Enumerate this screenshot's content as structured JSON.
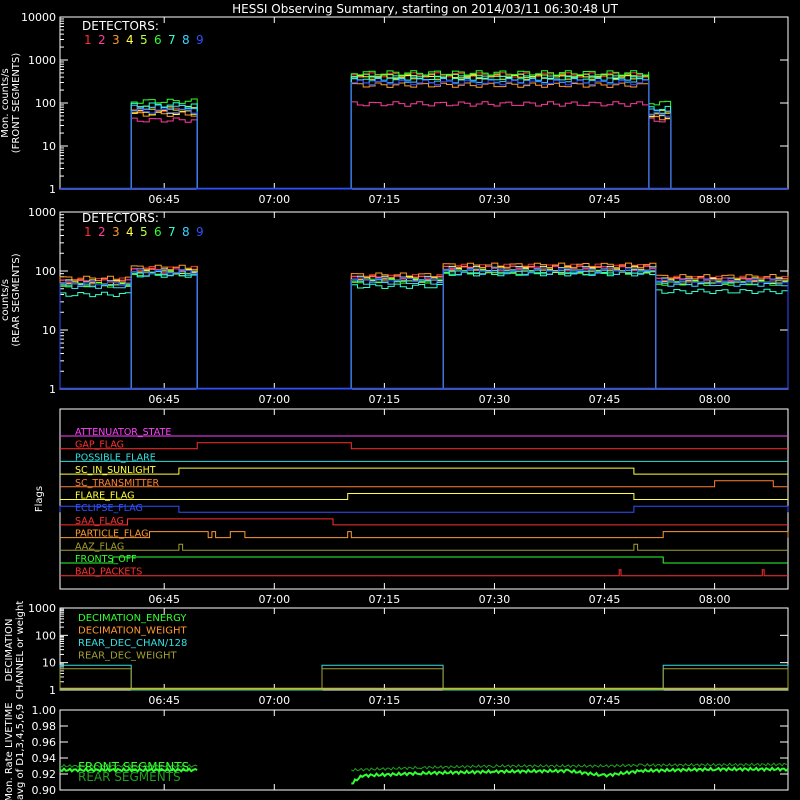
{
  "title": "HESSI Observing Summary, starting on 2014/03/11 06:30:48 UT",
  "colors": {
    "frame": "#ffffff",
    "background": "#000000",
    "det": [
      "#ff3030",
      "#ff3ca0",
      "#ff9a30",
      "#ffff40",
      "#b8ff40",
      "#30ff30",
      "#30ffd0",
      "#40d0ff",
      "#3050ff"
    ]
  },
  "time_axis": {
    "start": "06:30:48",
    "end": "08:10:00",
    "tick_labels": [
      "06:45",
      "07:00",
      "07:15",
      "07:30",
      "07:45",
      "08:00"
    ]
  },
  "detectors_legend": {
    "label": "DETECTORS:",
    "numbers": [
      "1",
      "2",
      "3",
      "4",
      "5",
      "6",
      "7",
      "8",
      "9"
    ]
  },
  "front_panel": {
    "ylabel_line1": "Mon. counts/s",
    "ylabel_line2": "(FRONT SEGMENTS)",
    "ytick_labels": [
      "10000",
      "1000",
      "100",
      "10",
      "1"
    ]
  },
  "rear_panel": {
    "ylabel_line1": "counts/s",
    "ylabel_line2": "(REAR SEGMENTS)",
    "ytick_labels": [
      "1000",
      "100",
      "10",
      "1"
    ]
  },
  "flags_panel": {
    "ylabel": "Flags",
    "flags": [
      {
        "name": "ATTENUATOR_STATE",
        "color": "#ff40ff"
      },
      {
        "name": "GAP_FLAG",
        "color": "#ff3030"
      },
      {
        "name": "POSSIBLE_FLARE",
        "color": "#30e0e0"
      },
      {
        "name": "SC_IN_SUNLIGHT",
        "color": "#ffff40"
      },
      {
        "name": "SC_TRANSMITTER",
        "color": "#ff8030"
      },
      {
        "name": "FLARE_FLAG",
        "color": "#ffff40"
      },
      {
        "name": "ECLIPSE_FLAG",
        "color": "#3050ff"
      },
      {
        "name": "SAA_FLAG",
        "color": "#ff3030"
      },
      {
        "name": "PARTICLE_FLAG",
        "color": "#ff9a30"
      },
      {
        "name": "AAZ_FLAG",
        "color": "#a0a030"
      },
      {
        "name": "FRONTS_OFF",
        "color": "#30ff30"
      },
      {
        "name": "BAD_PACKETS",
        "color": "#ff3030"
      }
    ]
  },
  "decimation_panel": {
    "ylabel_line1": "DECIMATION",
    "ylabel_line2": "CHANNEL or weight",
    "ytick_labels": [
      "1000",
      "100",
      "10",
      "1"
    ],
    "legend": [
      {
        "name": "DECIMATION_ENERGY",
        "color": "#30ff30"
      },
      {
        "name": "DECIMATION_WEIGHT",
        "color": "#ff9a30"
      },
      {
        "name": "REAR_DEC_CHAN/128",
        "color": "#30e0e0"
      },
      {
        "name": "REAR_DEC_WEIGHT",
        "color": "#a0a030"
      }
    ]
  },
  "livetime_panel": {
    "ylabel_line1": "Mon. Rate LIVETIME",
    "ylabel_line2": "avg of D1,3,4,5,6,9",
    "ytick_labels": [
      "1.00",
      "0.98",
      "0.96",
      "0.94",
      "0.92",
      "0.90"
    ],
    "legend": [
      {
        "name": "FRONT SEGMENTS",
        "color": "#30ff30"
      },
      {
        "name": "REAR SEGMENTS",
        "color": "#20a020"
      }
    ]
  },
  "chart_data": [
    {
      "type": "line",
      "panel": "front",
      "scale": "log",
      "ylim": [
        1,
        10000
      ],
      "segments": [
        {
          "start": "06:40:30",
          "end": "06:49:30",
          "det_values": [
            70,
            40,
            55,
            60,
            75,
            110,
            90,
            80,
            65
          ]
        },
        {
          "start": "07:10:30",
          "end": "07:51:00",
          "det_values": [
            450,
            95,
            260,
            400,
            420,
            500,
            380,
            330,
            300
          ]
        },
        {
          "start": "07:51:00",
          "end": "07:54:00",
          "det_values": [
            55,
            40,
            45,
            50,
            60,
            100,
            75,
            65,
            55
          ]
        }
      ],
      "baseline": 1
    },
    {
      "type": "line",
      "panel": "rear",
      "scale": "log",
      "ylim": [
        1,
        1000
      ],
      "segments": [
        {
          "start": "06:30:48",
          "end": "06:40:30",
          "det_values": [
            70,
            65,
            75,
            65,
            60,
            58,
            40,
            55,
            62
          ]
        },
        {
          "start": "06:40:30",
          "end": "06:49:30",
          "det_values": [
            110,
            100,
            115,
            100,
            95,
            90,
            85,
            90,
            98
          ]
        },
        {
          "start": "07:10:30",
          "end": "07:23:00",
          "det_values": [
            80,
            75,
            85,
            75,
            70,
            68,
            55,
            65,
            72
          ]
        },
        {
          "start": "07:23:00",
          "end": "07:52:00",
          "det_values": [
            120,
            110,
            125,
            110,
            100,
            95,
            90,
            95,
            105
          ]
        },
        {
          "start": "07:52:00",
          "end": "08:10:00",
          "det_values": [
            75,
            70,
            80,
            70,
            65,
            62,
            45,
            60,
            68
          ]
        }
      ],
      "baseline": 1
    },
    {
      "type": "table",
      "panel": "flags",
      "flags": [
        {
          "name": "ATTENUATOR_STATE",
          "intervals": []
        },
        {
          "name": "GAP_FLAG",
          "intervals": [
            [
              "06:49:30",
              "07:10:30"
            ]
          ]
        },
        {
          "name": "POSSIBLE_FLARE",
          "intervals": []
        },
        {
          "name": "SC_IN_SUNLIGHT",
          "intervals": [
            [
              "06:47:00",
              "07:49:00"
            ]
          ]
        },
        {
          "name": "SC_TRANSMITTER",
          "intervals": [
            [
              "08:00:00",
              "08:08:00"
            ]
          ]
        },
        {
          "name": "FLARE_FLAG",
          "intervals": [
            [
              "07:10:00",
              "07:49:00"
            ]
          ]
        },
        {
          "name": "ECLIPSE_FLAG",
          "intervals": [
            [
              "06:30:48",
              "06:47:00"
            ],
            [
              "07:49:00",
              "08:10:00"
            ]
          ]
        },
        {
          "name": "SAA_FLAG",
          "intervals": [
            [
              "06:40:00",
              "07:08:00"
            ]
          ]
        },
        {
          "name": "PARTICLE_FLAG",
          "intervals": [
            [
              "06:43:00",
              "06:51:00"
            ],
            [
              "06:51:30",
              "06:52:00"
            ],
            [
              "06:54:00",
              "06:56:00"
            ],
            [
              "07:10:00",
              "07:10:30"
            ],
            [
              "07:53:00",
              "08:10:00"
            ]
          ]
        },
        {
          "name": "AAZ_FLAG",
          "intervals": [
            [
              "06:47:00",
              "06:47:30"
            ],
            [
              "07:49:00",
              "07:49:30"
            ]
          ]
        },
        {
          "name": "FRONTS_OFF",
          "intervals": [
            [
              "06:38:00",
              "07:53:00"
            ]
          ]
        },
        {
          "name": "BAD_PACKETS",
          "intervals": [
            [
              "07:47:00",
              "07:47:15"
            ],
            [
              "08:06:30",
              "08:06:45"
            ]
          ]
        }
      ]
    },
    {
      "type": "line",
      "panel": "decimation",
      "scale": "log",
      "ylim": [
        1,
        1000
      ],
      "series": [
        {
          "name": "REAR_DEC_CHAN/128",
          "intervals": [
            [
              "06:30:48",
              "06:40:30",
              8
            ],
            [
              "07:06:30",
              "07:23:00",
              8
            ],
            [
              "07:53:00",
              "08:10:00",
              8
            ]
          ],
          "baseline": 1
        },
        {
          "name": "REAR_DEC_WEIGHT",
          "intervals": [
            [
              "06:30:48",
              "06:40:30",
              6
            ],
            [
              "07:06:30",
              "07:23:00",
              6
            ],
            [
              "07:53:00",
              "08:10:00",
              6
            ]
          ],
          "baseline": 1
        },
        {
          "name": "DECIMATION_ENERGY",
          "intervals": [],
          "baseline": 1
        },
        {
          "name": "DECIMATION_WEIGHT",
          "intervals": [],
          "baseline": 1
        }
      ]
    },
    {
      "type": "line",
      "panel": "livetime",
      "ylim": [
        0.9,
        1.0
      ],
      "series": [
        {
          "name": "FRONT SEGMENTS",
          "points": [
            [
              "06:30:48",
              0.925
            ],
            [
              "06:49:30",
              0.925
            ],
            [
              "07:10:30",
              0.908
            ],
            [
              "07:12:00",
              0.918
            ],
            [
              "07:20:00",
              0.921
            ],
            [
              "07:30:00",
              0.923
            ],
            [
              "07:40:00",
              0.924
            ],
            [
              "07:45:00",
              0.918
            ],
            [
              "07:50:00",
              0.924
            ],
            [
              "08:00:00",
              0.926
            ],
            [
              "08:10:00",
              0.926
            ]
          ]
        },
        {
          "name": "REAR SEGMENTS",
          "points": [
            [
              "06:30:48",
              0.93
            ],
            [
              "06:49:30",
              0.93
            ],
            [
              "07:10:30",
              0.925
            ],
            [
              "07:20:00",
              0.928
            ],
            [
              "07:30:00",
              0.93
            ],
            [
              "07:45:00",
              0.93
            ],
            [
              "07:50:00",
              0.931
            ],
            [
              "08:10:00",
              0.932
            ]
          ]
        }
      ]
    }
  ]
}
